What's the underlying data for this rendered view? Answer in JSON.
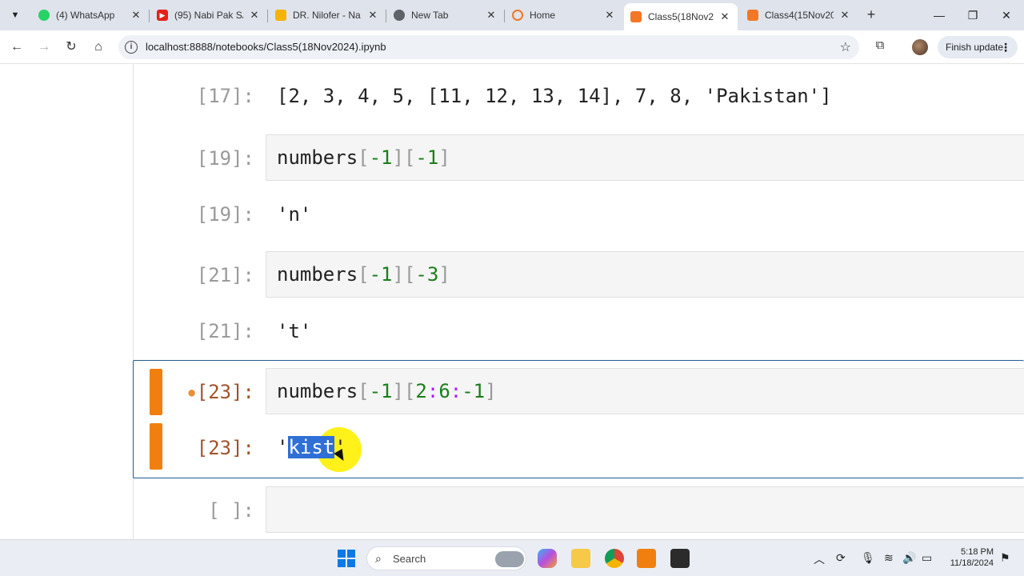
{
  "browser": {
    "tabs": [
      {
        "title": "(4) WhatsApp",
        "icon": "whatsapp-icon"
      },
      {
        "title": "(95) Nabi Pak SA",
        "icon": "youtube-icon"
      },
      {
        "title": "DR. Nilofer - Na",
        "icon": "slides-icon"
      },
      {
        "title": "New Tab",
        "icon": "chrome-icon"
      },
      {
        "title": "Home",
        "icon": "jupyter-icon"
      },
      {
        "title": "Class5(18Nov20",
        "icon": "notebook-icon",
        "active": true
      },
      {
        "title": "Class4(15Nov20",
        "icon": "notebook-icon"
      }
    ],
    "url": "localhost:8888/notebooks/Class5(18Nov2024).ipynb",
    "finish_update": "Finish update"
  },
  "notebook": {
    "out17": {
      "prompt": "[17]:",
      "text": "[2, 3, 4, 5, [11, 12, 13, 14], 7, 8, 'Pakistan']"
    },
    "in19": {
      "prompt": "[19]:",
      "name": "numbers",
      "i1": "-1",
      "i2": "-1"
    },
    "out19": {
      "prompt": "[19]:",
      "text": "'n'"
    },
    "in21": {
      "prompt": "[21]:",
      "name": "numbers",
      "i1": "-1",
      "i2": "-3"
    },
    "out21": {
      "prompt": "[21]:",
      "text": "'t'"
    },
    "in23": {
      "prompt": "[23]:",
      "name": "numbers",
      "i1": "-1",
      "s1": "2",
      "s2": "6",
      "s3": "-1"
    },
    "out23": {
      "prompt": "[23]:",
      "quote_open": "'",
      "selected": "kist",
      "quote_close": "'"
    },
    "empty": {
      "prompt": "[ ]:"
    }
  },
  "taskbar": {
    "search_label": "Search",
    "time": "5:18 PM",
    "date": "11/18/2024"
  }
}
